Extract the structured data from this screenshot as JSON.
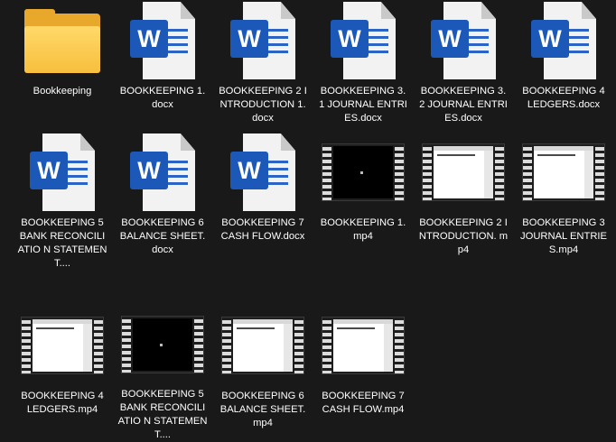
{
  "items": [
    {
      "label": "Bookkeeping",
      "type": "folder",
      "icon": "folder-icon"
    },
    {
      "label": "BOOKKEEPING 1.docx",
      "type": "word",
      "icon": "word-document-icon"
    },
    {
      "label": "BOOKKEEPING 2 INTRODUCTION 1.docx",
      "type": "word",
      "icon": "word-document-icon"
    },
    {
      "label": "BOOKKEEPING 3.1 JOURNAL ENTRIES.docx",
      "type": "word",
      "icon": "word-document-icon"
    },
    {
      "label": "BOOKKEEPING 3.2 JOURNAL ENTRIES.docx",
      "type": "word",
      "icon": "word-document-icon"
    },
    {
      "label": "BOOKKEEPING 4 LEDGERS.docx",
      "type": "word",
      "icon": "word-document-icon"
    },
    {
      "label": "BOOKKEEPING 5 BANK RECONCILIATIO N STATEMENT....",
      "type": "word",
      "icon": "word-document-icon"
    },
    {
      "label": "BOOKKEEPING 6 BALANCE SHEET.docx",
      "type": "word",
      "icon": "word-document-icon"
    },
    {
      "label": "BOOKKEEPING 7 CASH FLOW.docx",
      "type": "word",
      "icon": "word-document-icon"
    },
    {
      "label": "BOOKKEEPING 1.mp4",
      "type": "video",
      "icon": "video-thumbnail-icon",
      "dark": true
    },
    {
      "label": "BOOKKEEPING 2 INTRODUCTION. mp4",
      "type": "video",
      "icon": "video-thumbnail-icon",
      "dark": false
    },
    {
      "label": "BOOKKEEPING 3 JOURNAL ENTRIES.mp4",
      "type": "video",
      "icon": "video-thumbnail-icon",
      "dark": false
    },
    {
      "label": "BOOKKEEPING 4 LEDGERS.mp4",
      "type": "video",
      "icon": "video-thumbnail-icon",
      "dark": false
    },
    {
      "label": "BOOKKEEPING 5 BANK RECONCILIATIO N STATEMENT....",
      "type": "video",
      "icon": "video-thumbnail-icon",
      "dark": true
    },
    {
      "label": "BOOKKEEPING 6 BALANCE SHEET.mp4",
      "type": "video",
      "icon": "video-thumbnail-icon",
      "dark": false
    },
    {
      "label": "BOOKKEEPING 7 CASH FLOW.mp4",
      "type": "video",
      "icon": "video-thumbnail-icon",
      "dark": false
    }
  ],
  "colors": {
    "background": "#191919",
    "text": "#ffffff",
    "folder": "#f7bf3d",
    "word_blue": "#1b58b8"
  }
}
